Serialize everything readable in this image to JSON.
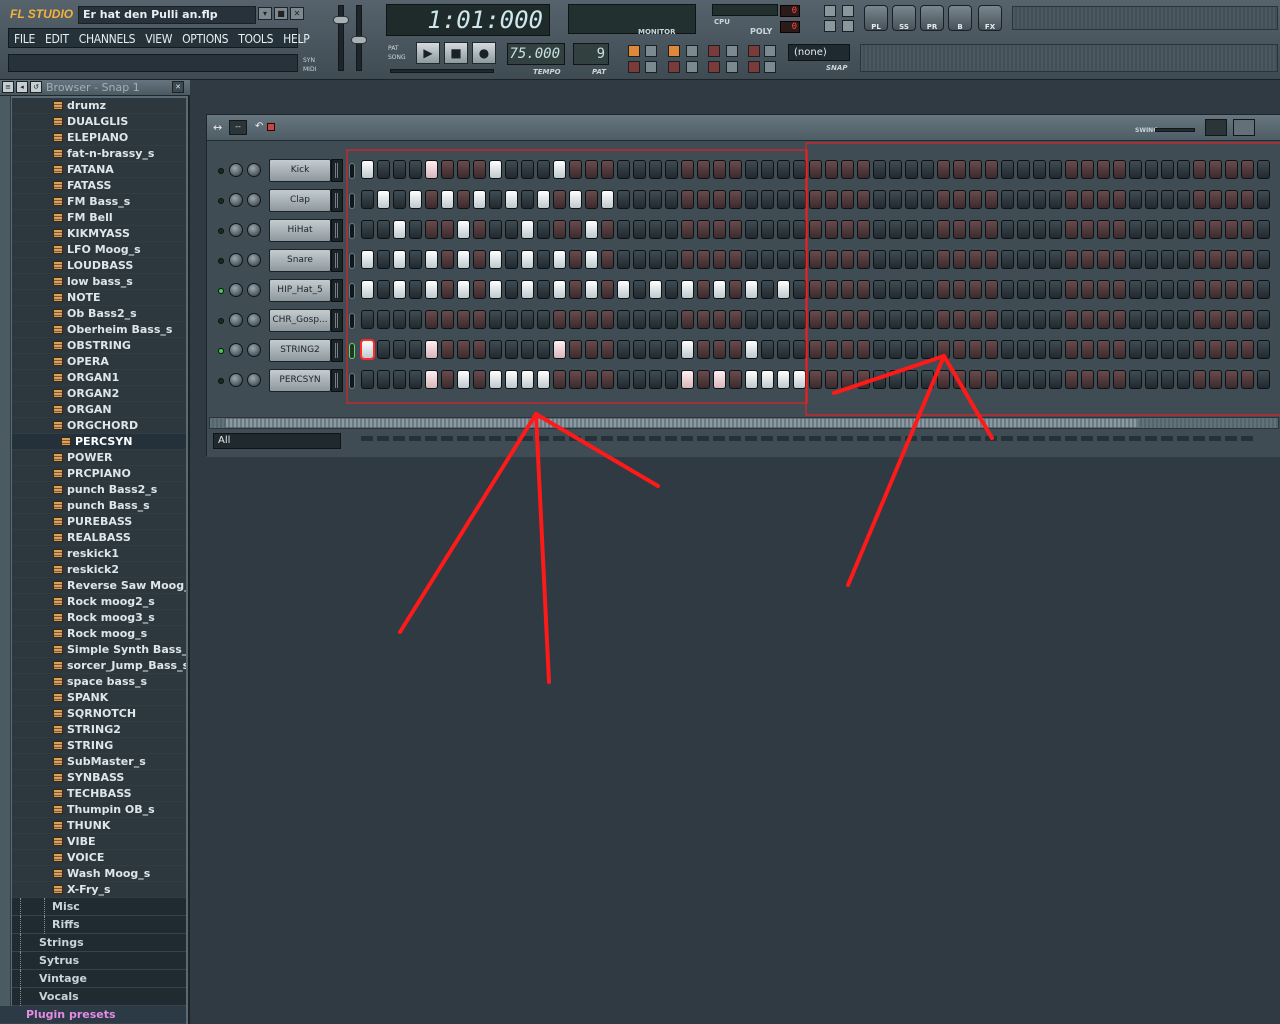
{
  "app": {
    "logo": "FL STUDIO",
    "project_title": "Er hat den Pulli an.flp",
    "window_buttons": [
      "▾",
      "■",
      "✕"
    ]
  },
  "menu": [
    "FILE",
    "EDIT",
    "CHANNELS",
    "VIEW",
    "OPTIONS",
    "TOOLS",
    "HELP"
  ],
  "indicators": {
    "syn": "SYN",
    "midi": "MIDI",
    "pat": "PAT",
    "song": "SONG"
  },
  "time_display": "1:01:000",
  "monitor_label": "MONITOR",
  "cpu_label": "CPU",
  "poly_label": "POLY",
  "cpu_value": "0",
  "poly_value": "0",
  "tempo": {
    "value": "75.000",
    "label": "TEMPO"
  },
  "pattern": {
    "value": "9",
    "label": "PAT"
  },
  "snap": {
    "value": "(none)",
    "label": "SNAP"
  },
  "window_icons": [
    "PL",
    "SS",
    "PR",
    "B",
    "FX"
  ],
  "browser": {
    "title": "Browser - Snap 1",
    "files": [
      "drumz",
      "DUALGLIS",
      "ELEPIANO",
      "fat-n-brassy_s",
      "FATANA",
      "FATASS",
      "FM Bass_s",
      "FM Bell",
      "KIKMYASS",
      "LFO Moog_s",
      "LOUDBASS",
      "low bass_s",
      "NOTE",
      "Ob Bass2_s",
      "Oberheim Bass_s",
      "OBSTRING",
      "OPERA",
      "ORGAN1",
      "ORGAN2",
      "ORGAN",
      "ORGCHORD",
      "PERCSYN",
      "POWER",
      "PRCPIANO",
      "punch Bass2_s",
      "punch Bass_s",
      "PUREBASS",
      "REALBASS",
      "reskick1",
      "reskick2",
      "Reverse Saw Moog_s",
      "Rock moog2_s",
      "Rock moog3_s",
      "Rock moog_s",
      "Simple Synth Bass_s",
      "sorcer_Jump_Bass_s",
      "space bass_s",
      "SPANK",
      "SQRNOTCH",
      "STRING2",
      "STRING",
      "SubMaster_s",
      "SYNBASS",
      "TECHBASS",
      "Thumpin OB_s",
      "THUNK",
      "VIBE",
      "VOICE",
      "Wash Moog_s",
      "X-Fry_s"
    ],
    "selected_index": 21,
    "folders": [
      {
        "name": "Misc",
        "depth": 2
      },
      {
        "name": "Riffs",
        "depth": 2
      },
      {
        "name": "Strings",
        "depth": 1
      },
      {
        "name": "Sytrus",
        "depth": 1
      },
      {
        "name": "Vintage",
        "depth": 1
      },
      {
        "name": "Vocals",
        "depth": 1
      }
    ],
    "plugin_presets": "Plugin presets"
  },
  "sequencer": {
    "swing_label": "SWING",
    "filter": "All",
    "channels": [
      {
        "name": "Kick",
        "on": [
          0,
          4,
          8,
          12
        ]
      },
      {
        "name": "Clap",
        "on": [
          1,
          3,
          5,
          7,
          9,
          11,
          13,
          15
        ]
      },
      {
        "name": "HiHat",
        "on": [
          2,
          6,
          10,
          14
        ]
      },
      {
        "name": "Snare",
        "on": [
          0,
          2,
          4,
          6,
          8,
          10,
          12,
          14
        ]
      },
      {
        "name": "HIP_Hat_5",
        "on": [
          0,
          2,
          4,
          6,
          8,
          10,
          12,
          14,
          16,
          18,
          20,
          22,
          24,
          26
        ]
      },
      {
        "name": "CHR_Gosp...",
        "on": []
      },
      {
        "name": "STRING2",
        "on": [
          0,
          4,
          12,
          20,
          24
        ]
      },
      {
        "name": "PERCSYN",
        "on": [
          4,
          6,
          8,
          9,
          10,
          11,
          20,
          22,
          24,
          25,
          26,
          27
        ]
      }
    ],
    "pink_steps": [
      [
        4
      ],
      [],
      [],
      [],
      [],
      [],
      [
        4,
        12
      ],
      [
        4,
        20,
        22
      ]
    ],
    "visible_steps": 57
  },
  "annotation_color": "#ff1a1a"
}
